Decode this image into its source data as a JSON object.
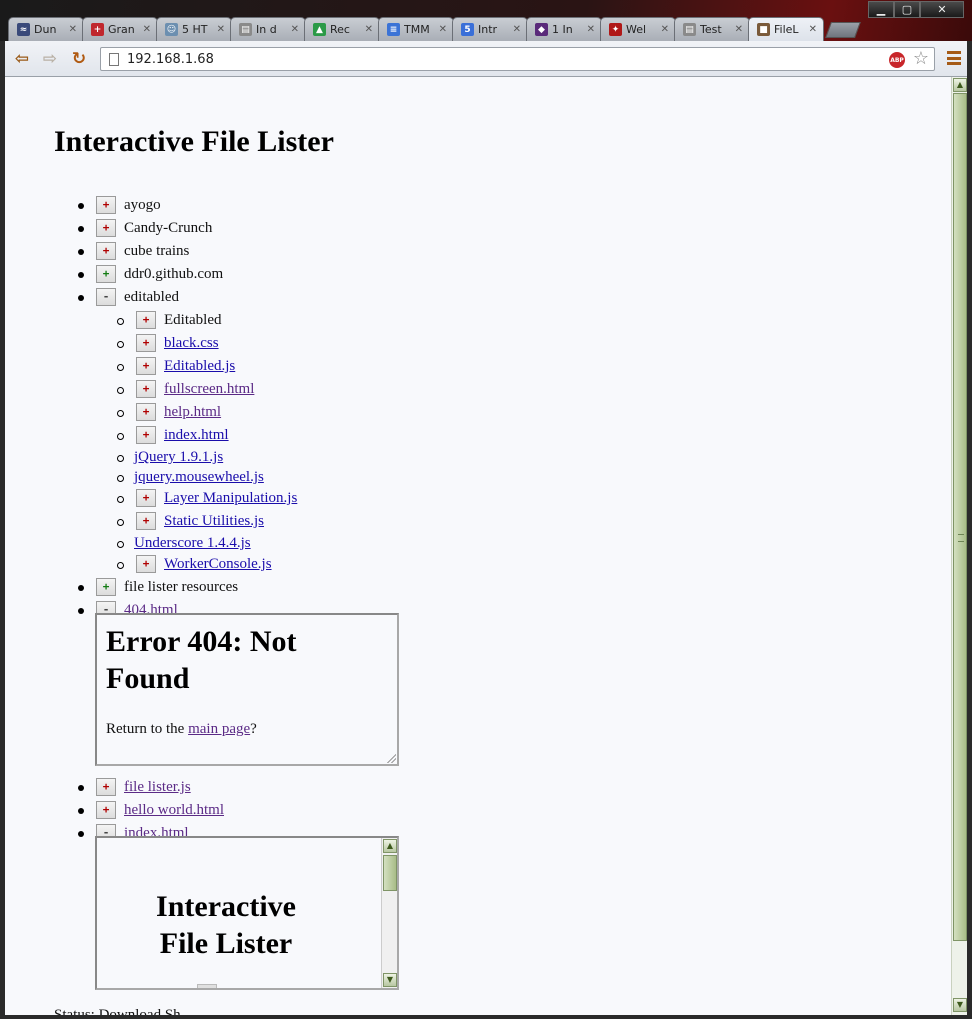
{
  "window": {
    "controls": {
      "minimize": "▁",
      "maximize": "▢",
      "close": "✕"
    },
    "tabs": [
      {
        "title": "Dun",
        "icon": "dungeon-icon",
        "color": "#3a4a7a",
        "glyph": "≈"
      },
      {
        "title": "Gran",
        "icon": "red-cross-icon",
        "color": "#c0272d",
        "glyph": "+"
      },
      {
        "title": "5 HT",
        "icon": "person-icon",
        "color": "#6c8fb0",
        "glyph": "☺"
      },
      {
        "title": "In d",
        "icon": "page-icon",
        "color": "#8a8a8a",
        "glyph": "▤"
      },
      {
        "title": "Rec",
        "icon": "drive-icon",
        "color": "#2b9a47",
        "glyph": "▲"
      },
      {
        "title": "TMM",
        "icon": "doc-icon",
        "color": "#3b73d6",
        "glyph": "≡"
      },
      {
        "title": "Intr",
        "icon": "html5-icon",
        "color": "#3a6fd8",
        "glyph": "5"
      },
      {
        "title": "1 In",
        "icon": "drop-icon",
        "color": "#5a2a7a",
        "glyph": "◆"
      },
      {
        "title": "Wel",
        "icon": "dragon-icon",
        "color": "#b01818",
        "glyph": "✦"
      },
      {
        "title": "Test",
        "icon": "page-icon",
        "color": "#8a8a8a",
        "glyph": "▤"
      },
      {
        "title": "FileL",
        "icon": "box-icon",
        "color": "#7a5a3a",
        "glyph": "■",
        "active": true
      }
    ]
  },
  "toolbar": {
    "url": "192.168.1.68",
    "adblock_label": "ABP",
    "star": "☆",
    "back": "⇦",
    "forward": "⇨",
    "reload": "↻"
  },
  "page": {
    "title": "Interactive File Lister",
    "tree": [
      {
        "toggle": "+",
        "label": "ayogo",
        "kind": "folder"
      },
      {
        "toggle": "+",
        "label": "Candy-Crunch",
        "kind": "folder"
      },
      {
        "toggle": "+",
        "label": "cube trains",
        "kind": "folder"
      },
      {
        "toggle": "+",
        "label": "ddr0.github.com",
        "kind": "folder",
        "green": true
      },
      {
        "toggle": "-",
        "label": "editabled",
        "kind": "folder"
      },
      {
        "toggle": "+",
        "label": "Editabled",
        "kind": "folder",
        "depth": 1
      },
      {
        "toggle": "+",
        "label": "black.css",
        "kind": "link",
        "depth": 1
      },
      {
        "toggle": "+",
        "label": "Editabled.js",
        "kind": "link",
        "depth": 1
      },
      {
        "toggle": "+",
        "label": "fullscreen.html",
        "kind": "visited",
        "depth": 1
      },
      {
        "toggle": "+",
        "label": "help.html",
        "kind": "visited",
        "depth": 1
      },
      {
        "toggle": "+",
        "label": "index.html",
        "kind": "link",
        "depth": 1
      },
      {
        "toggle": "",
        "label": "jQuery 1.9.1.js",
        "kind": "link",
        "depth": 1
      },
      {
        "toggle": "",
        "label": "jquery.mousewheel.js",
        "kind": "link",
        "depth": 1
      },
      {
        "toggle": "+",
        "label": "Layer Manipulation.js",
        "kind": "link",
        "depth": 1
      },
      {
        "toggle": "+",
        "label": "Static Utilities.js",
        "kind": "link",
        "depth": 1
      },
      {
        "toggle": "",
        "label": "Underscore 1.4.4.js",
        "kind": "link",
        "depth": 1
      },
      {
        "toggle": "+",
        "label": "WorkerConsole.js",
        "kind": "link",
        "depth": 1
      },
      {
        "toggle": "+",
        "label": "file lister resources",
        "kind": "folder",
        "green": true
      },
      {
        "toggle": "-",
        "label": "404.html",
        "kind": "visited"
      },
      {
        "toggle": "+",
        "label": "file lister.js",
        "kind": "visited"
      },
      {
        "toggle": "+",
        "label": "hello world.html",
        "kind": "visited"
      },
      {
        "toggle": "-",
        "label": "index.html",
        "kind": "visited"
      }
    ],
    "preview_404": {
      "heading": "Error 404: Not Found",
      "text_before": "Return to the ",
      "link": "main page",
      "text_after": "?"
    },
    "preview_index": {
      "heading": "Interactive File Lister"
    },
    "status": "Status: Download Sh..."
  }
}
